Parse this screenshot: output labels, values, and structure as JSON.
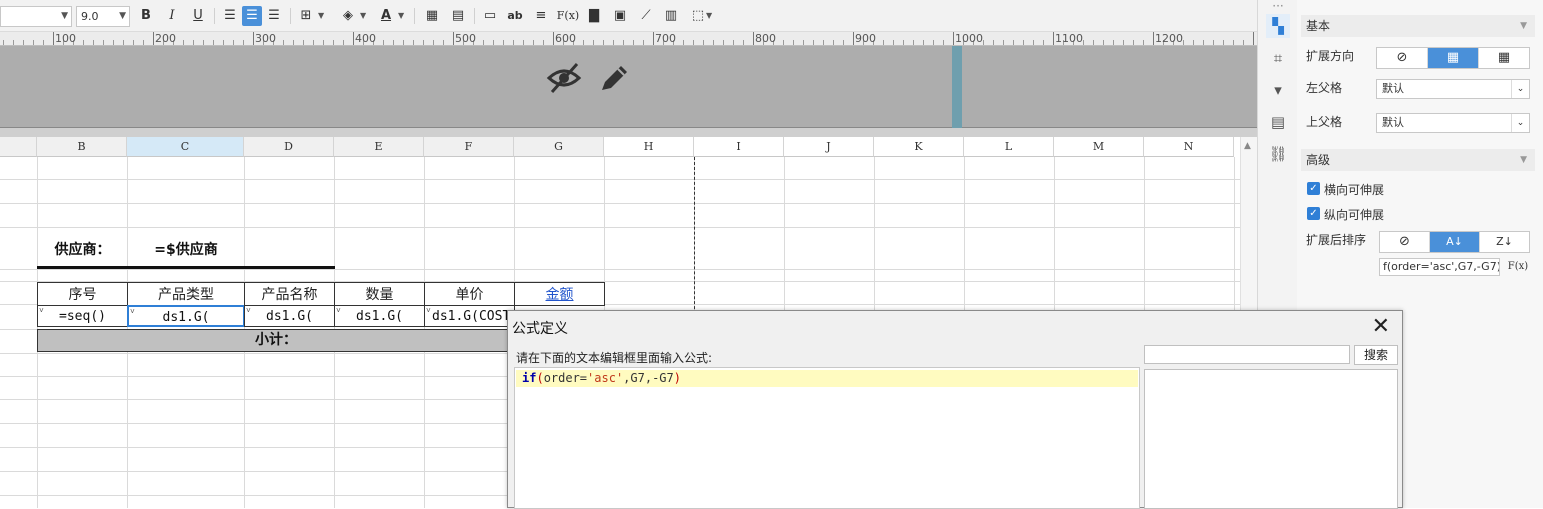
{
  "toolbar": {
    "font_value": "",
    "font_size": "9.0",
    "bold": "B",
    "italic": "I",
    "underline": "U",
    "text_direction": "ab",
    "fx": "F(x)"
  },
  "ruler": {
    "labels": [
      "100",
      "200",
      "300",
      "400",
      "500",
      "600",
      "700",
      "800",
      "900",
      "1000",
      "1100",
      "1200"
    ]
  },
  "columns": [
    "B",
    "C",
    "D",
    "E",
    "F",
    "G",
    "H",
    "I",
    "J",
    "K",
    "L",
    "M",
    "N"
  ],
  "sheet": {
    "supplier_label": "供应商：",
    "supplier_value": "=$供应商",
    "headers": [
      "序号",
      "产品类型",
      "产品名称",
      "数量",
      "单价",
      "金额"
    ],
    "row": [
      "=seq()",
      "ds1.G(",
      "ds1.G(",
      "ds1.G(",
      "ds1.G(COST"
    ],
    "subtotal": "小计："
  },
  "panel": {
    "basic": "基本",
    "expand_direction": "扩展方向",
    "left_parent": "左父格",
    "left_parent_value": "默认",
    "top_parent": "上父格",
    "top_parent_value": "默认",
    "advanced": "高级",
    "horizontal_expand": "横向可伸展",
    "vertical_expand": "纵向可伸展",
    "sort_after_expand": "扩展后排序",
    "formula_value": "f(order='asc',G7,-G7)",
    "fx_label": "F(x)"
  },
  "dialog": {
    "title": "公式定义",
    "close": "✕",
    "hint": "请在下面的文本编辑框里面输入公式:",
    "search_button": "搜索",
    "formula_kw": "if",
    "formula_open": "(",
    "formula_mid1": "order=",
    "formula_str": "'asc'",
    "formula_mid2": ",G7,-G7",
    "formula_close": ")"
  }
}
